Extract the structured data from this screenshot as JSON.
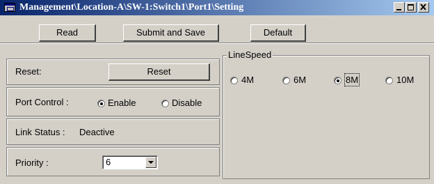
{
  "window": {
    "title": "Management\\Location-A\\SW-1:Switch1\\Port1\\Setting"
  },
  "toolbar": {
    "read_label": "Read",
    "submit_label": "Submit and Save",
    "default_label": "Default"
  },
  "reset": {
    "label": "Reset:",
    "button_label": "Reset"
  },
  "port_control": {
    "label": "Port Control :",
    "options": [
      "Enable",
      "Disable"
    ],
    "selected": "Enable"
  },
  "link_status": {
    "label": "Link Status :",
    "value": "Deactive"
  },
  "priority": {
    "label": "Priority :",
    "selected_value": "6"
  },
  "line_speed": {
    "title": "LineSpeed",
    "options": [
      "4M",
      "6M",
      "8M",
      "10M"
    ],
    "selected": "8M"
  }
}
